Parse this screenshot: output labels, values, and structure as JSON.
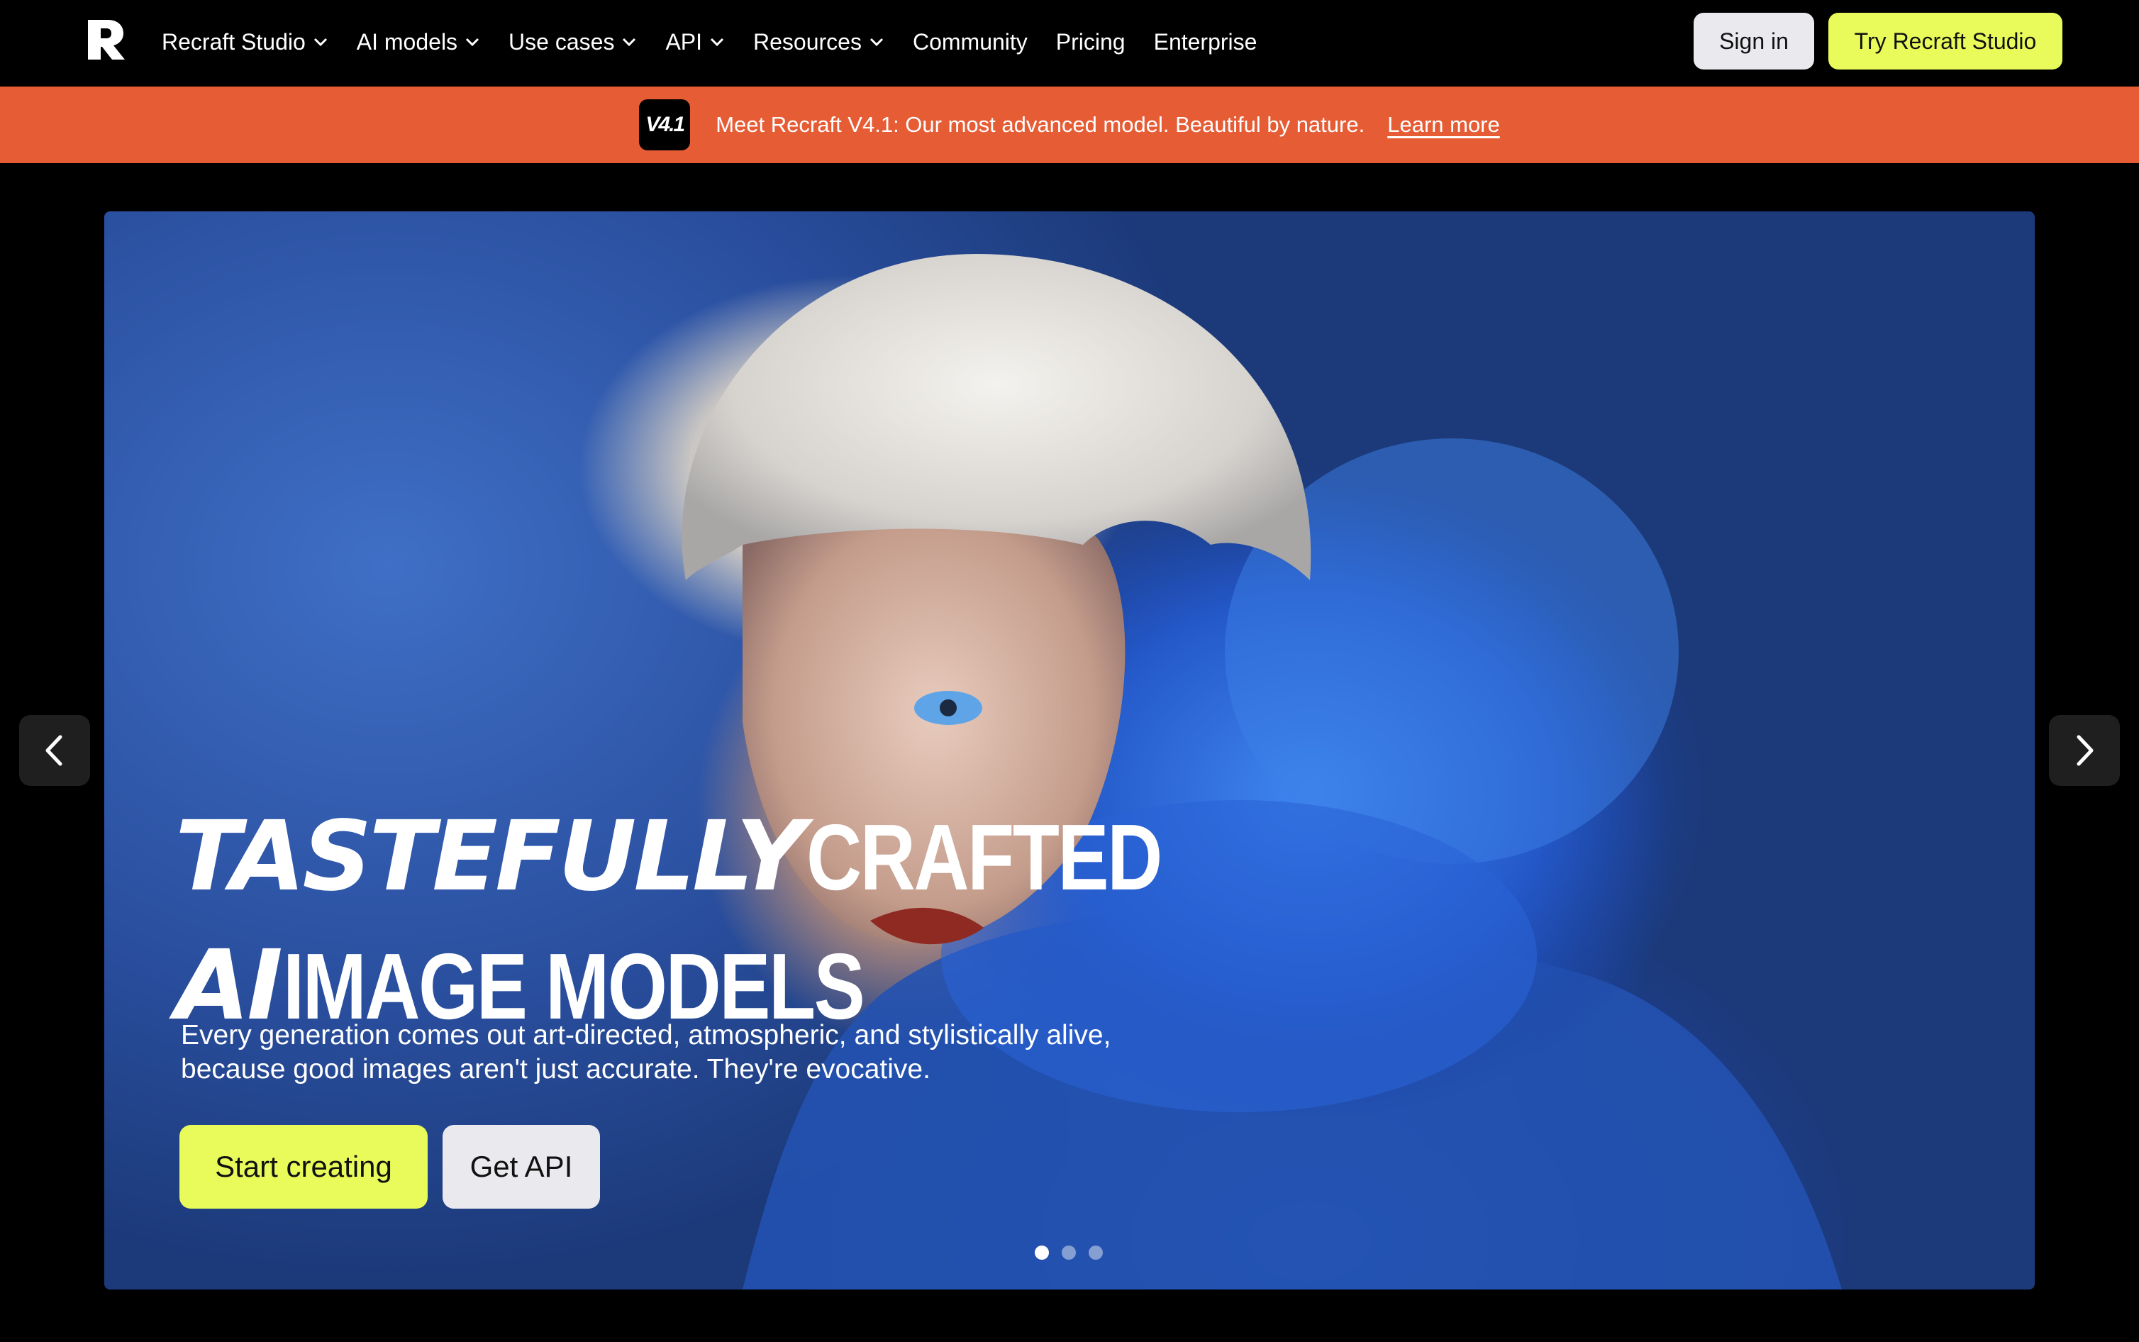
{
  "nav": {
    "items": [
      {
        "label": "Recraft Studio",
        "dropdown": true
      },
      {
        "label": "AI models",
        "dropdown": true
      },
      {
        "label": "Use cases",
        "dropdown": true
      },
      {
        "label": "API",
        "dropdown": true
      },
      {
        "label": "Resources",
        "dropdown": true
      },
      {
        "label": "Community",
        "dropdown": false
      },
      {
        "label": "Pricing",
        "dropdown": false
      },
      {
        "label": "Enterprise",
        "dropdown": false
      }
    ],
    "sign_in": "Sign in",
    "try_studio": "Try Recraft Studio"
  },
  "banner": {
    "badge": "V4.1",
    "text": "Meet Recraft V4.1: Our most advanced model. Beautiful by nature.",
    "link": "Learn more"
  },
  "hero": {
    "heading_line1_italic": "TASTEFULLY",
    "heading_line1_rest": "CRAFTED",
    "heading_line2_italic": "AI",
    "heading_line2_rest": "IMAGE MODELS",
    "subtitle": "Every generation comes out art-directed, atmospheric, and stylistically alive, because good images aren't just accurate. They're evocative.",
    "primary_cta": "Start creating",
    "secondary_cta": "Get API"
  },
  "carousel": {
    "slide_count": 3,
    "active_slide": 1
  },
  "colors": {
    "accent_lime": "#e8fb5a",
    "banner_orange": "#e65c35",
    "hero_blue": "#2a4f9f",
    "background": "#000000"
  },
  "icons": {
    "logo": "recraft-logo-icon",
    "dropdown": "chevron-down-icon",
    "prev": "chevron-left-icon",
    "next": "chevron-right-icon"
  }
}
